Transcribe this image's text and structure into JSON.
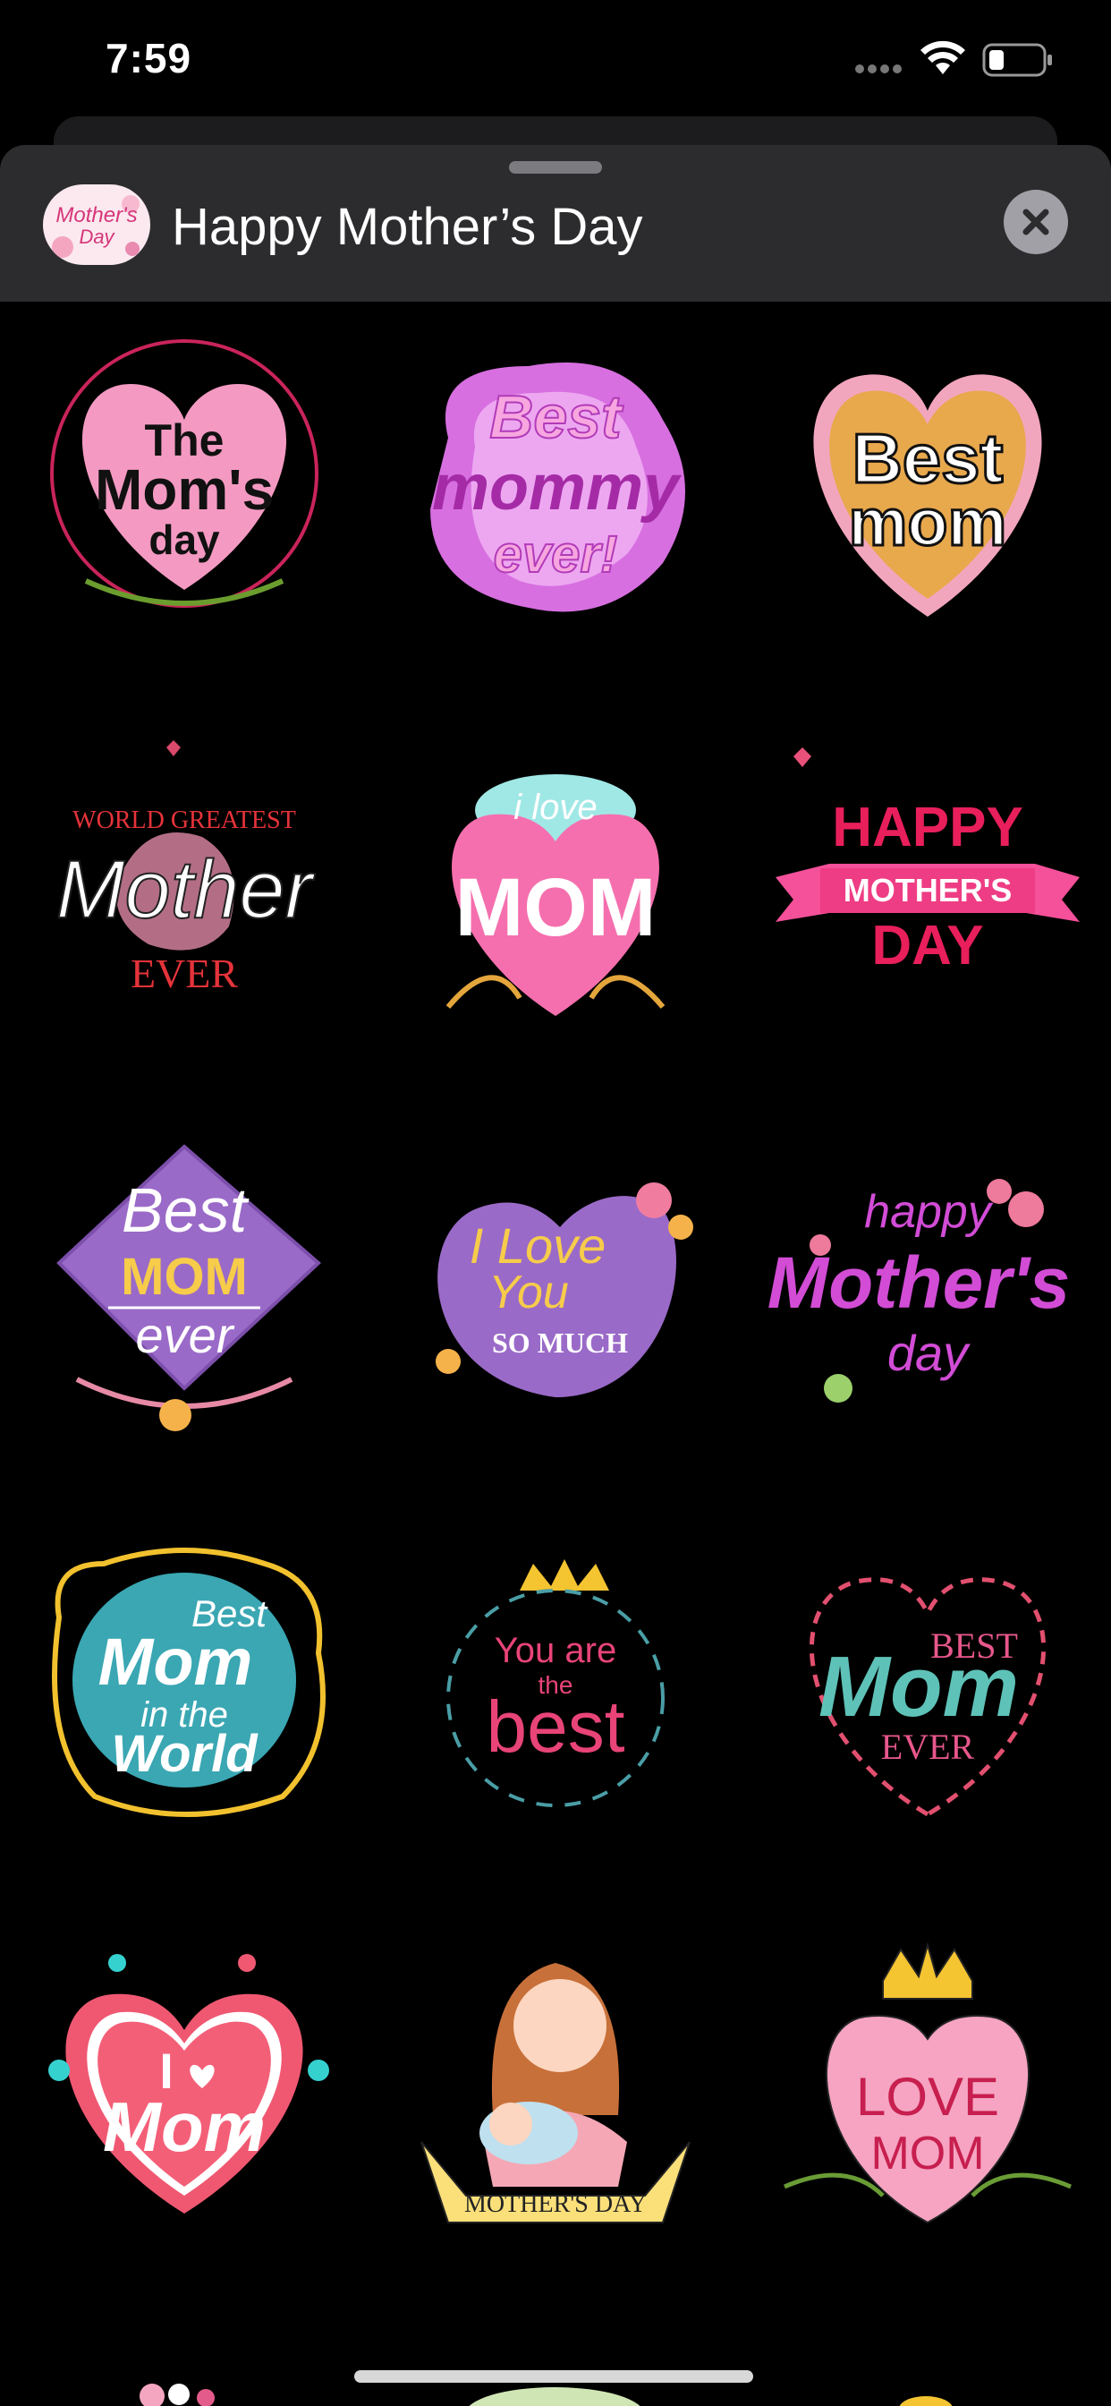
{
  "status_bar": {
    "time": "7:59"
  },
  "header": {
    "title": "Happy Mother’s Day",
    "app_icon_text_line1": "Mother's",
    "app_icon_text_line2": "Day"
  },
  "stickers": [
    {
      "name": "sticker-the-moms-day",
      "lines": [
        "The",
        "Mom's",
        "day"
      ]
    },
    {
      "name": "sticker-best-mommy-ever",
      "lines": [
        "Best",
        "mommy",
        "ever!"
      ]
    },
    {
      "name": "sticker-best-mom-gold",
      "lines": [
        "Best",
        "mom"
      ]
    },
    {
      "name": "sticker-world-greatest-mother",
      "lines": [
        "WORLD GREATEST",
        "Mother",
        "EVER"
      ]
    },
    {
      "name": "sticker-i-love-mom",
      "lines": [
        "i love",
        "MOM"
      ]
    },
    {
      "name": "sticker-happy-mothers-day-banner",
      "lines": [
        "HAPPY",
        "MOTHER'S",
        "DAY"
      ]
    },
    {
      "name": "sticker-best-mom-ever-purple",
      "lines": [
        "Best",
        "MOM",
        "ever"
      ]
    },
    {
      "name": "sticker-i-love-you-so-much",
      "lines": [
        "I Love",
        "You",
        "SO MUCH"
      ]
    },
    {
      "name": "sticker-happy-mothers-day-script",
      "lines": [
        "happy",
        "Mother's",
        "day"
      ]
    },
    {
      "name": "sticker-best-mom-in-the-world",
      "lines": [
        "Best",
        "Mom",
        "in the",
        "World"
      ]
    },
    {
      "name": "sticker-you-are-the-best",
      "lines": [
        "You are",
        "the",
        "best"
      ]
    },
    {
      "name": "sticker-best-mom-ever-wreath",
      "lines": [
        "BEST",
        "Mom",
        "EVER"
      ]
    },
    {
      "name": "sticker-i-heart-mom",
      "lines": [
        "I",
        "Mom"
      ]
    },
    {
      "name": "sticker-mothers-day-illustration",
      "lines": [
        "MOTHER'S DAY"
      ]
    },
    {
      "name": "sticker-love-mom-crown",
      "lines": [
        "LOVE",
        "MOM"
      ]
    }
  ]
}
